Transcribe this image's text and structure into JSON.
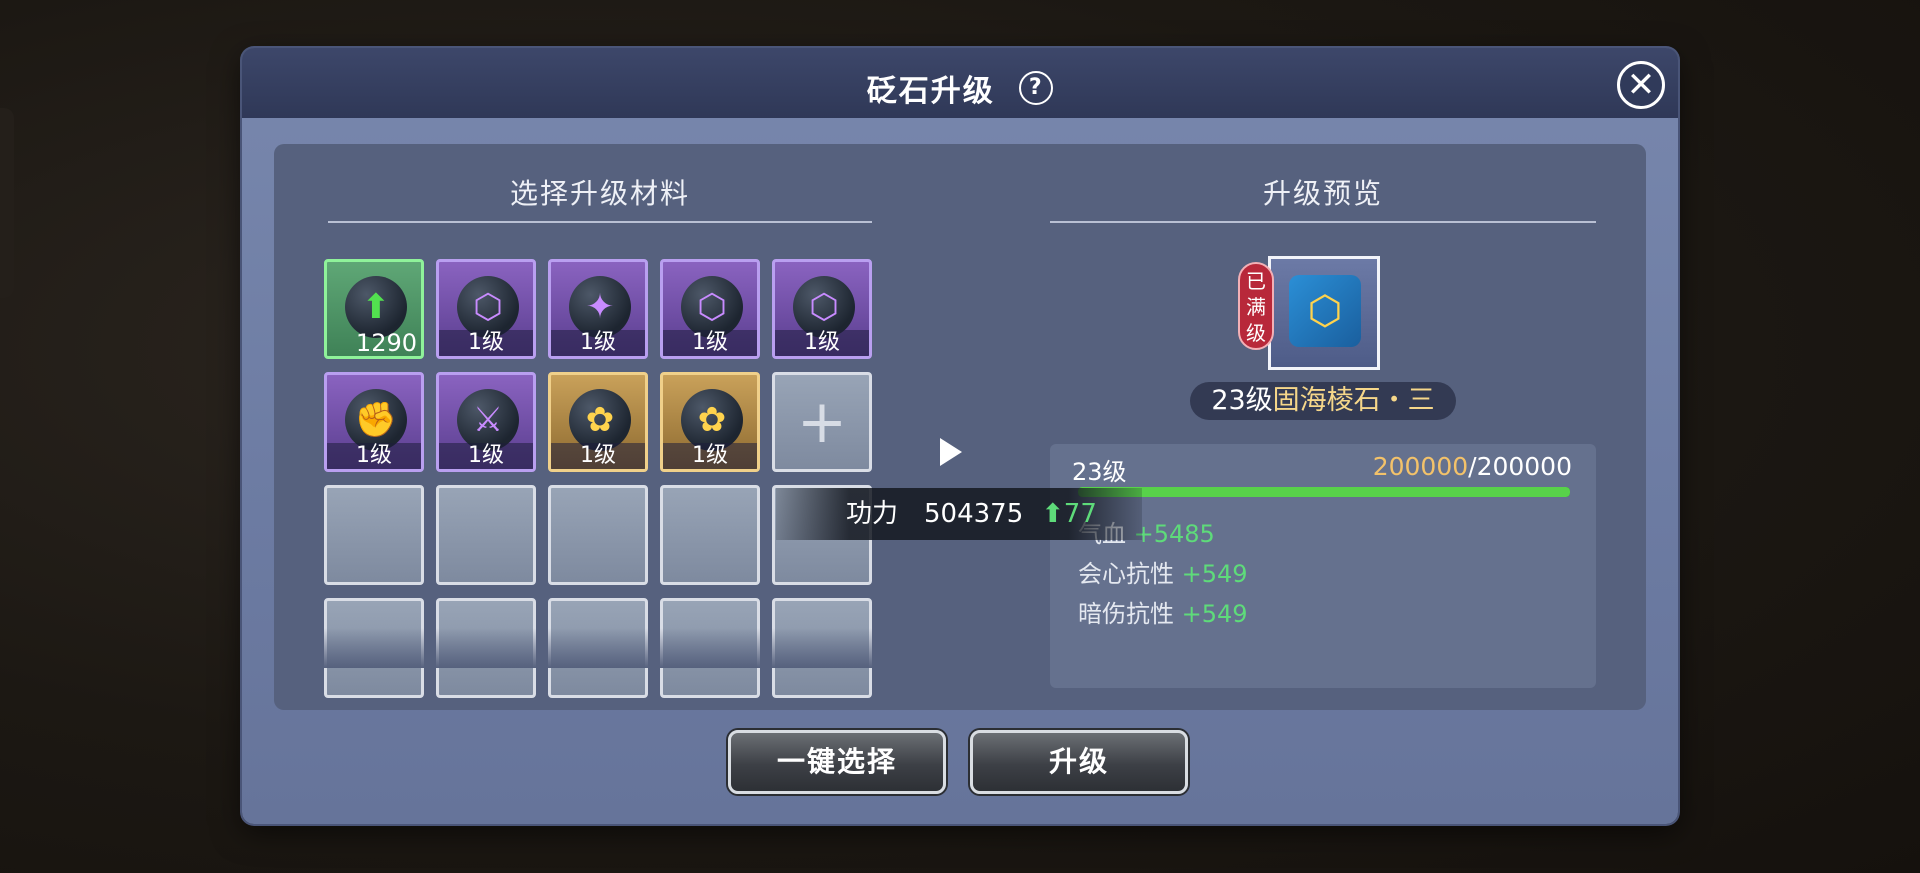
{
  "dialog": {
    "title": "砭石升级",
    "help_label": "?",
    "close_label": "✕"
  },
  "left": {
    "title": "选择升级材料",
    "slots": [
      {
        "type": "green",
        "icon": "green-arrow-upgrade-icon",
        "glyph": "⬆",
        "label": "1290"
      },
      {
        "type": "purple",
        "icon": "purple-shield-drop-icon",
        "glyph": "⬡",
        "label": "1级"
      },
      {
        "type": "purple",
        "icon": "purple-sword-shield-icon",
        "glyph": "✦",
        "label": "1级"
      },
      {
        "type": "purple",
        "icon": "purple-shield-drop-icon",
        "glyph": "⬡",
        "label": "1级"
      },
      {
        "type": "purple",
        "icon": "purple-shield-drop-icon",
        "glyph": "⬡",
        "label": "1级"
      },
      {
        "type": "purple",
        "icon": "purple-fist-icon",
        "glyph": "✊",
        "label": "1级"
      },
      {
        "type": "purple",
        "icon": "purple-blade-icon",
        "glyph": "⚔",
        "label": "1级"
      },
      {
        "type": "gold",
        "icon": "gold-lotus-icon",
        "glyph": "✿",
        "label": "1级"
      },
      {
        "type": "gold",
        "icon": "gold-lotus-icon",
        "glyph": "✿",
        "label": "1级"
      }
    ],
    "add_label": "+"
  },
  "right": {
    "title": "升级预览",
    "maxed_tag": "已满级",
    "stone_level": "23级",
    "stone_name": "固海棱石・三",
    "level": "23级",
    "exp_current": "200000",
    "exp_max": "/200000",
    "exp_progress": 1.0,
    "stats": [
      {
        "name": "气血",
        "value": "+5485"
      },
      {
        "name": "会心抗性",
        "value": "+549"
      },
      {
        "name": "暗伤抗性",
        "value": "+549"
      }
    ]
  },
  "power": {
    "label": "功力",
    "value": "504375",
    "up_arrow": "⬆",
    "delta": "77"
  },
  "buttons": {
    "auto_select": "一键选择",
    "upgrade": "升级"
  },
  "colors": {
    "accent_green": "#5edb7a",
    "exp_gold": "#f3c26a",
    "stone_name_gold": "#f6d78a",
    "maxed_red": "#b8283a"
  }
}
